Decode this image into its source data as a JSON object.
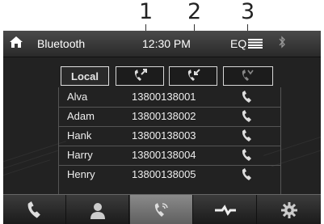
{
  "callouts": [
    "1",
    "2",
    "3"
  ],
  "statusbar": {
    "title": "Bluetooth",
    "time": "12:30 PM",
    "eq_label": "EQ"
  },
  "tabs": {
    "local_label": "Local"
  },
  "contacts": [
    {
      "name": "Alva",
      "number": "13800138001"
    },
    {
      "name": "Adam",
      "number": "13800138002"
    },
    {
      "name": "Hank",
      "number": "13800138003"
    },
    {
      "name": "Harry",
      "number": "13800138004"
    },
    {
      "name": "Henry",
      "number": "13800138005"
    }
  ],
  "icons": {
    "home": "home-icon",
    "equalizer": "equalizer-icon",
    "bluetooth": "bluetooth-icon",
    "dialed_calls": "dialed-calls-icon",
    "received_calls": "received-calls-icon",
    "missed_calls": "missed-calls-icon",
    "call": "phone-icon",
    "dial": "phone-icon",
    "contacts": "person-icon",
    "call_log": "call-log-icon",
    "link": "link-icon",
    "settings": "gear-icon"
  },
  "colors": {
    "background": "#222222",
    "text": "#eeeeee",
    "active_nav": "#7a7a7a"
  }
}
